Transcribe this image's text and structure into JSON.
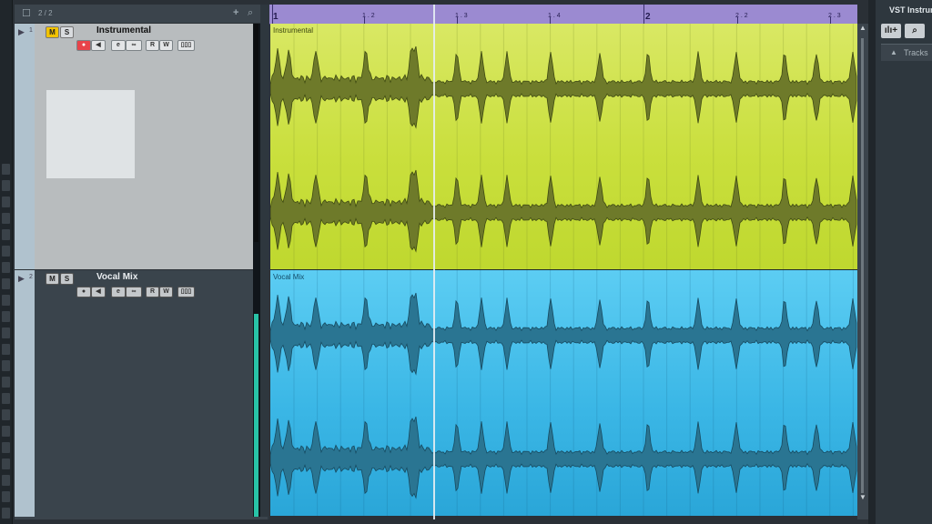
{
  "tracklist": {
    "count_label": "2 / 2",
    "add_icon": "plus-icon",
    "search_icon": "search-icon"
  },
  "tracks": [
    {
      "number": "1",
      "name": "Instrumental",
      "mute_label": "M",
      "solo_label": "S",
      "read_label": "R",
      "write_label": "W",
      "event_label": "Instrumental",
      "color": "#cfe247"
    },
    {
      "number": "2",
      "name": "Vocal Mix",
      "mute_label": "M",
      "solo_label": "S",
      "read_label": "R",
      "write_label": "W",
      "event_label": "Vocal Mix",
      "color": "#46bdeb"
    }
  ],
  "ruler": {
    "bar_1": "1",
    "beat_1_2": "1 . 2",
    "beat_1_3": "1 . 3",
    "beat_1_4": "1 . 4",
    "bar_2": "2",
    "beat_2_2": "2 . 2",
    "beat_2_3": "2 . 3"
  },
  "right_panel": {
    "title": "VST Instruments",
    "add_button": "ılı+",
    "search_icon": "search-icon",
    "tracks_label": "Tracks"
  },
  "colors": {
    "ruler": "#9b8ad1",
    "record": "#e8434a",
    "mute_active": "#f2c300",
    "meter": "#29c3a7"
  }
}
